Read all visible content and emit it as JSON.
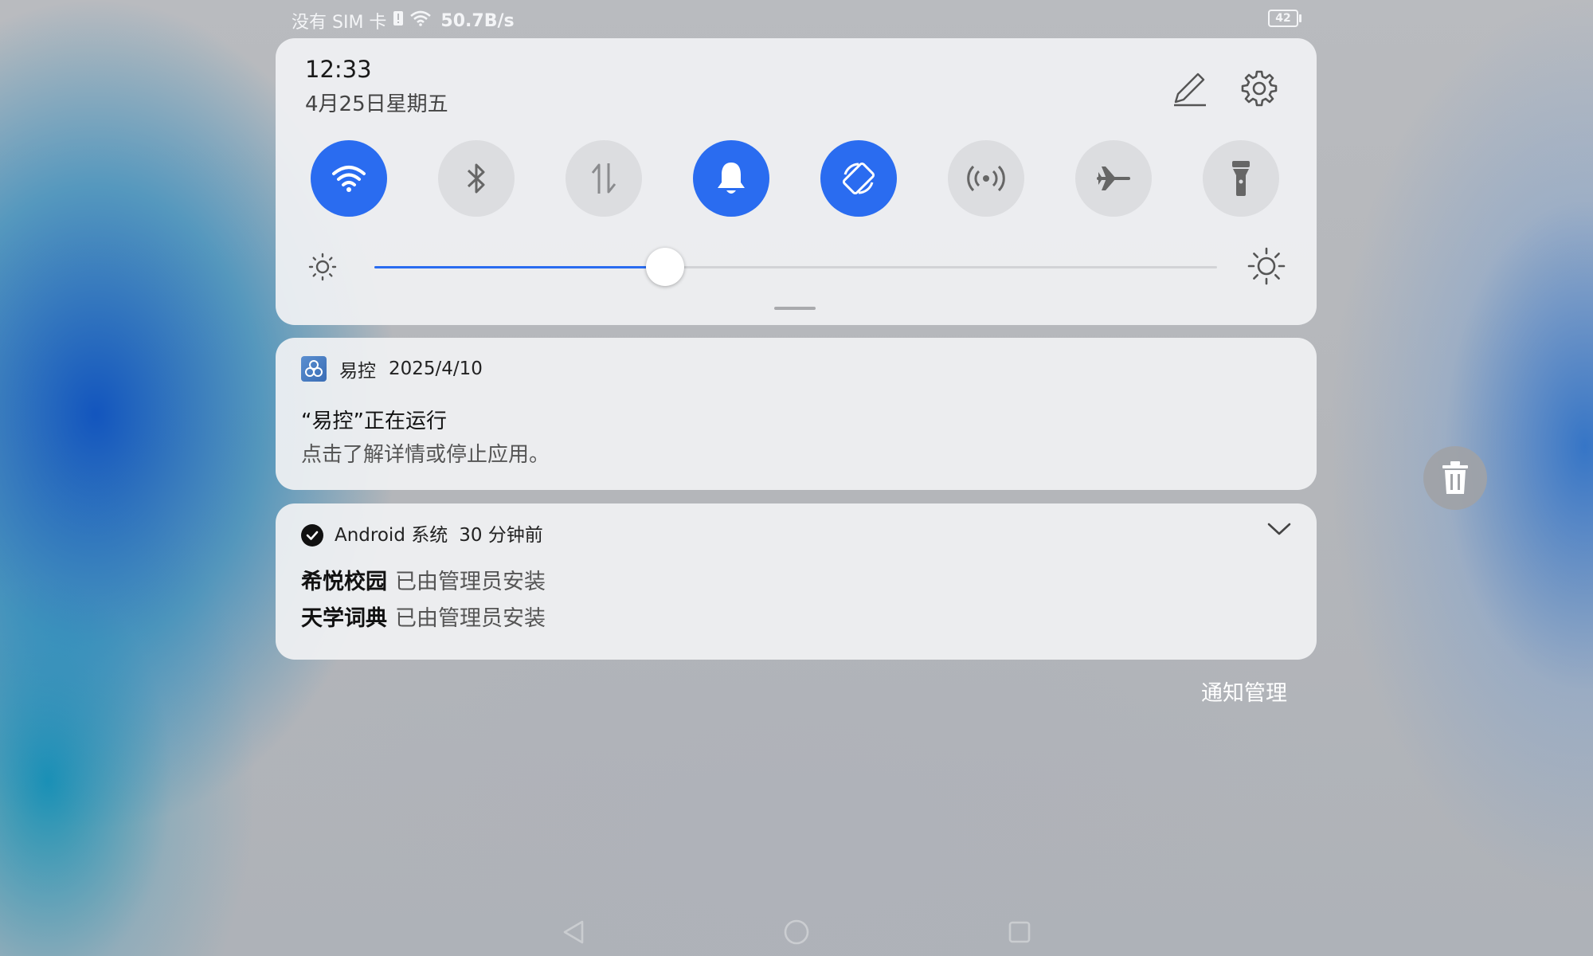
{
  "status_bar": {
    "carrier": "没有 SIM 卡",
    "speed": "50.7B/s",
    "battery": "42"
  },
  "quick_settings": {
    "time": "12:33",
    "date": "4月25日星期五",
    "toggles": [
      {
        "id": "wifi",
        "icon": "wifi-icon",
        "on": true
      },
      {
        "id": "bluetooth",
        "icon": "bluetooth-icon",
        "on": false
      },
      {
        "id": "mobile-data",
        "icon": "data-arrows-icon",
        "on": false
      },
      {
        "id": "sound",
        "icon": "bell-icon",
        "on": true
      },
      {
        "id": "auto-rotate",
        "icon": "rotate-icon",
        "on": true
      },
      {
        "id": "hotspot",
        "icon": "hotspot-icon",
        "on": false
      },
      {
        "id": "airplane",
        "icon": "airplane-icon",
        "on": false
      },
      {
        "id": "flashlight",
        "icon": "flashlight-icon",
        "on": false
      }
    ],
    "brightness_level": 0.345
  },
  "notifications": [
    {
      "app_name": "易控",
      "time": "2025/4/10",
      "title": "“易控”正在运行",
      "body": "点击了解详情或停止应用。"
    },
    {
      "app_name": "Android 系统",
      "time": "30 分钟前",
      "items": [
        {
          "name": "希悦校园",
          "desc": "已由管理员安装"
        },
        {
          "name": "天学词典",
          "desc": "已由管理员安装"
        }
      ]
    }
  ],
  "manage_label": "通知管理",
  "colors": {
    "accent": "#2a6cf0",
    "toggle_off": "#dcdde0",
    "panel": "#f0f1f3"
  }
}
